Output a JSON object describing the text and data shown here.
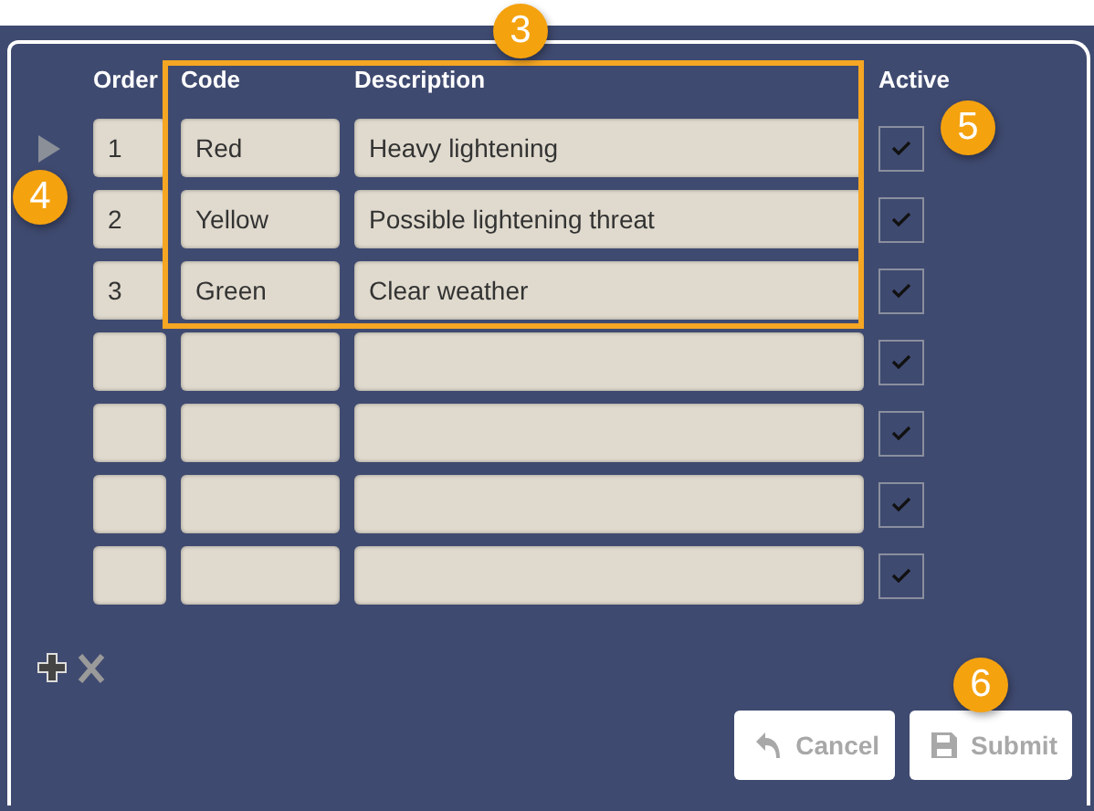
{
  "columns": [
    "Order",
    "Code",
    "Description",
    "Active"
  ],
  "rows": [
    {
      "current": true,
      "order": "1",
      "code": "Red",
      "description": "Heavy lightening",
      "checked": true
    },
    {
      "current": false,
      "order": "2",
      "code": "Yellow",
      "description": "Possible lightening threat",
      "checked": true
    },
    {
      "current": false,
      "order": "3",
      "code": "Green",
      "description": "Clear weather",
      "checked": true
    },
    {
      "current": false,
      "checked": true
    },
    {
      "current": false,
      "checked": true
    },
    {
      "current": false,
      "checked": true
    },
    {
      "current": false,
      "checked": true
    }
  ],
  "buttons": [
    {
      "kind": "cancel",
      "label": "Cancel",
      "disabled": true
    },
    {
      "kind": "submit",
      "label": "Submit",
      "disabled": true
    }
  ],
  "callouts": [
    {
      "label": "3"
    },
    {
      "label": "4"
    },
    {
      "label": "5"
    },
    {
      "label": "6"
    }
  ]
}
